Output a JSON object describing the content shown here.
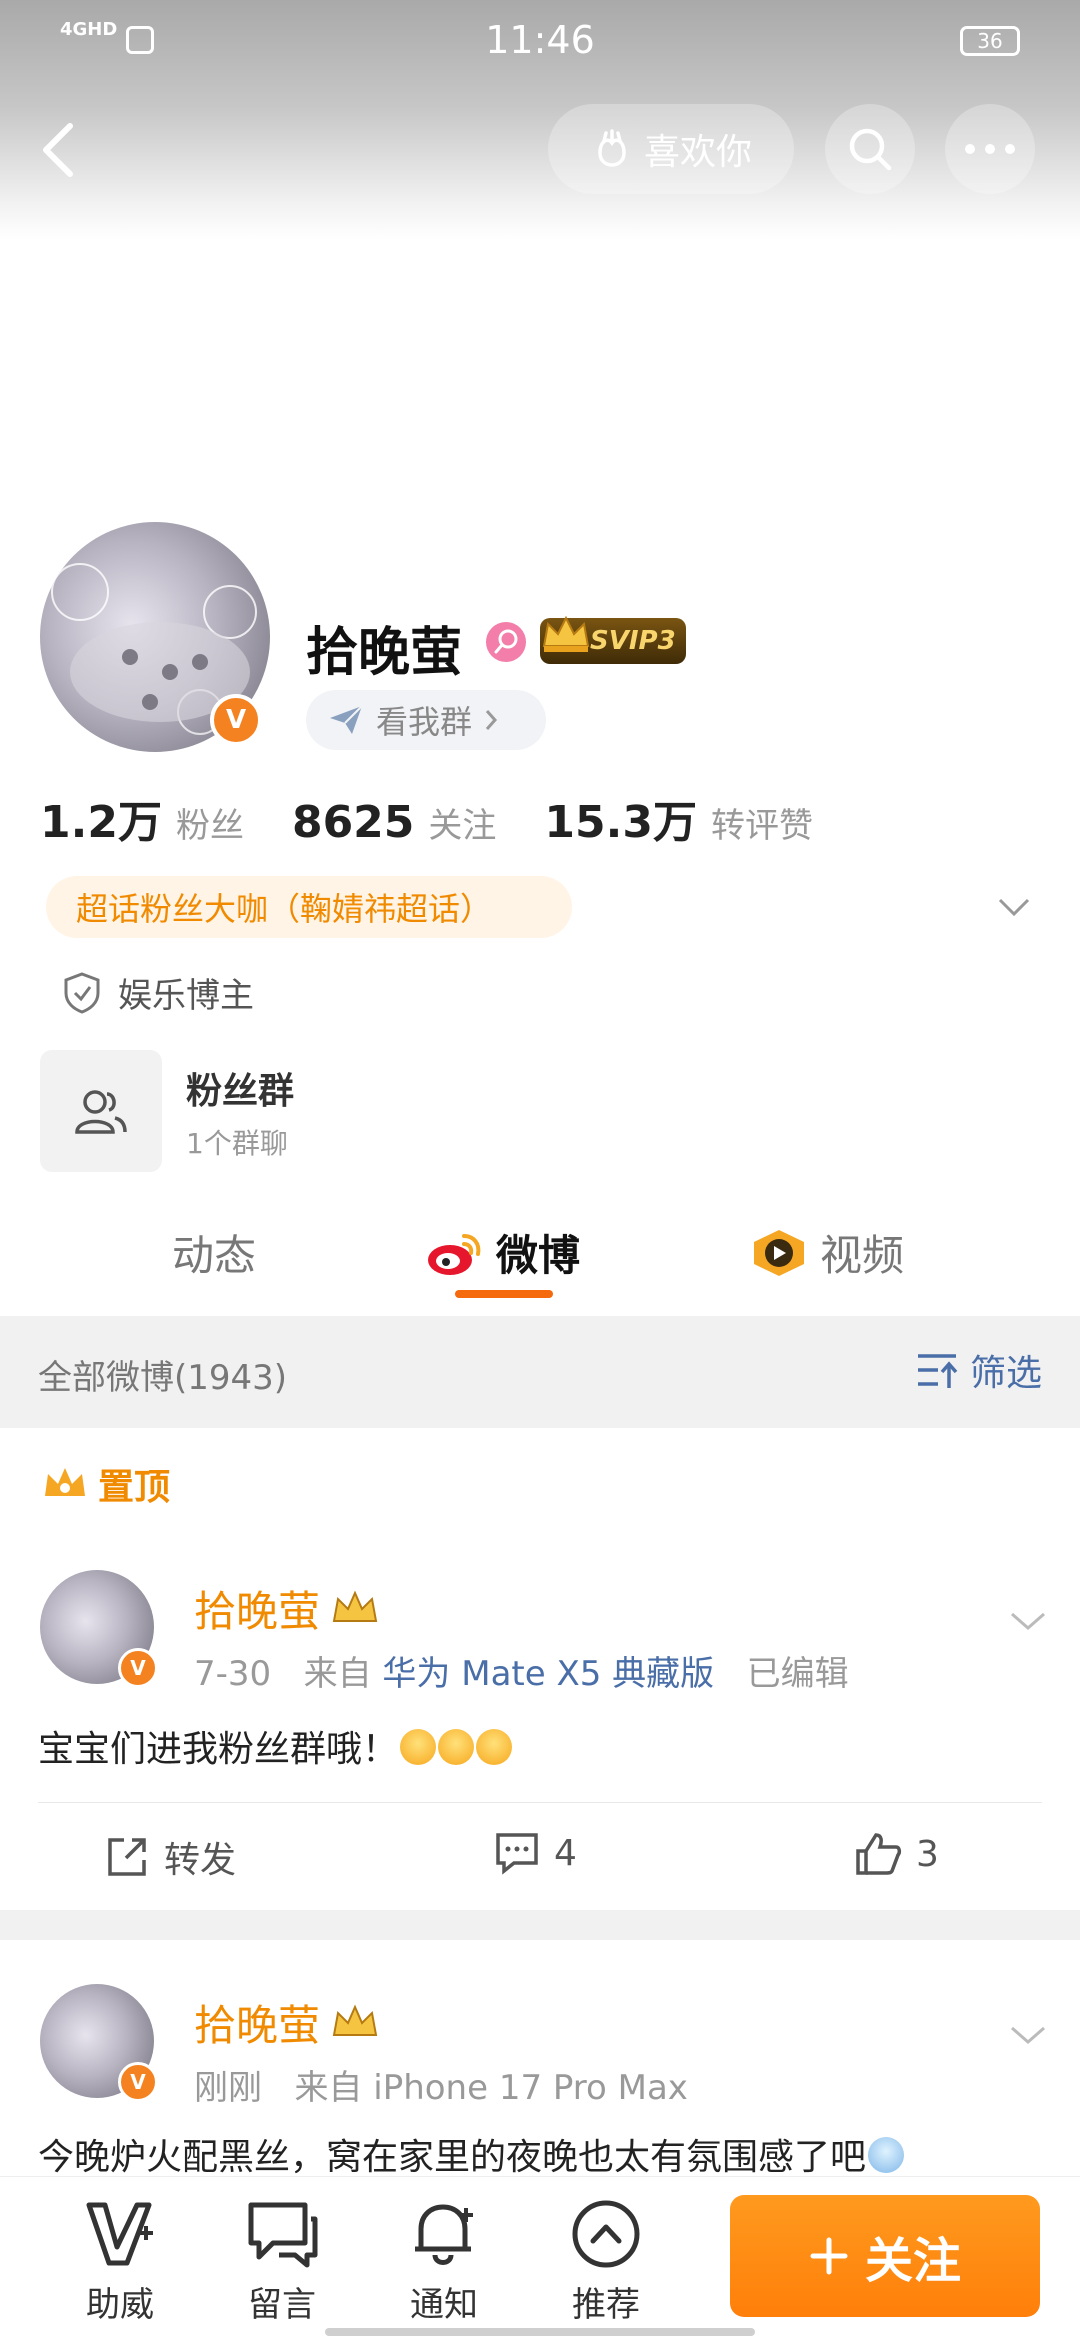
{
  "status_bar": {
    "network": "4GHD",
    "time": "11:46",
    "battery": "36"
  },
  "header": {
    "like_label": "喜欢你"
  },
  "profile": {
    "name": "拾晚萤",
    "vip_label": "SVIP3",
    "group_link": "看我群",
    "stats": [
      {
        "value": "1.2万",
        "label": "粉丝"
      },
      {
        "value": "8625",
        "label": "关注"
      },
      {
        "value": "15.3万",
        "label": "转评赞"
      }
    ],
    "supertopic_badge": "超话粉丝大咖（鞠婧祎超话）",
    "blogger_type": "娱乐博主",
    "fan_group": {
      "title": "粉丝群",
      "subtitle": "1个群聊"
    }
  },
  "tabs": [
    {
      "label": "动态",
      "active": false
    },
    {
      "label": "微博",
      "active": true
    },
    {
      "label": "视频",
      "active": false
    }
  ],
  "filter": {
    "title": "全部微博(1943)",
    "button": "筛选"
  },
  "pinned_label": "置顶",
  "posts": [
    {
      "author": "拾晚萤",
      "time": "7-30",
      "source_prefix": "来自",
      "device": "华为 Mate X5 典藏版",
      "edited": "已编辑",
      "text": "宝宝们进我粉丝群哦！",
      "actions": {
        "repost": "转发",
        "comments": "4",
        "likes": "3"
      }
    },
    {
      "author": "拾晚萤",
      "time": "刚刚",
      "source_prefix": "来自",
      "device": "iPhone 17 Pro Max",
      "text": "今晚炉火配黑丝，窝在家里的夜晚也太有氛围感了吧"
    }
  ],
  "bottom_nav": [
    {
      "label": "助威",
      "icon": "support-icon"
    },
    {
      "label": "留言",
      "icon": "message-icon"
    },
    {
      "label": "通知",
      "icon": "bell-icon"
    },
    {
      "label": "推荐",
      "icon": "chevron-up-icon"
    }
  ],
  "follow_button": "关注",
  "colors": {
    "accent": "#f08a00",
    "follow": "#ff8a12",
    "link": "#4a6ea7",
    "vip_badge": "#f58220"
  }
}
